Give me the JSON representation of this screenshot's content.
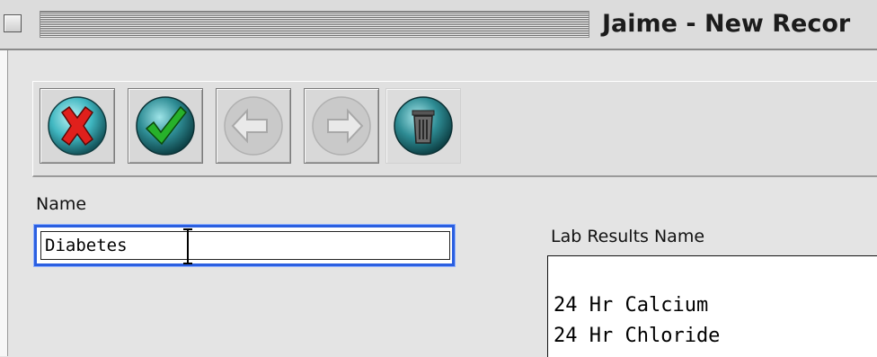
{
  "window": {
    "title": "Jaime - New Recor"
  },
  "toolbar": {
    "buttons": [
      {
        "name": "cancel",
        "icon": "red-x-icon",
        "enabled": true
      },
      {
        "name": "save",
        "icon": "green-check-icon",
        "enabled": true
      },
      {
        "name": "previous",
        "icon": "arrow-left-icon",
        "enabled": false
      },
      {
        "name": "next",
        "icon": "arrow-right-icon",
        "enabled": false
      },
      {
        "name": "delete",
        "icon": "trash-icon",
        "enabled": true
      }
    ]
  },
  "form": {
    "name_label": "Name",
    "name_value": "Diabetes",
    "lab_results_label": "Lab Results Name",
    "lab_results_items": [
      "",
      "24 Hr Calcium",
      "24 Hr Chloride"
    ]
  },
  "colors": {
    "focus_ring": "#2b5fe0",
    "cancel_red": "#e0201c",
    "save_green": "#27b12a",
    "button_teal": "#2e8c94"
  }
}
